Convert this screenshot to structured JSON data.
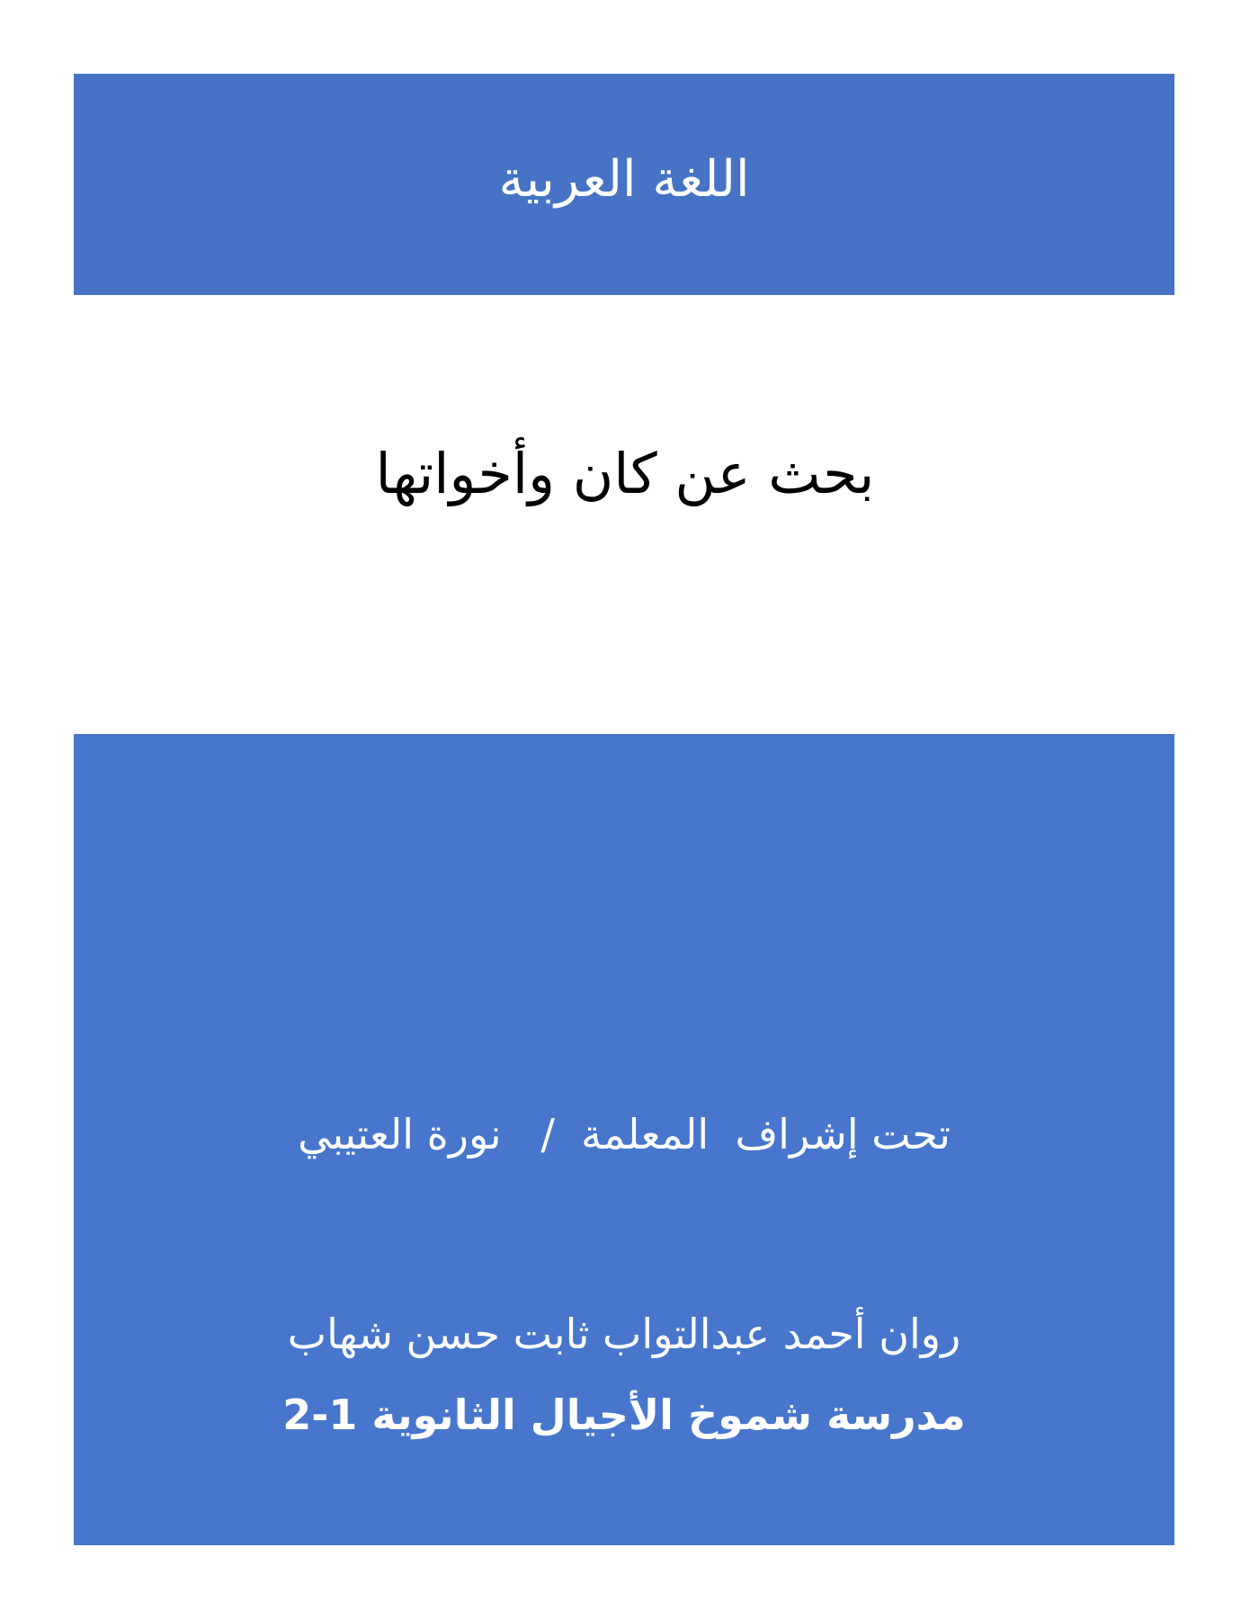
{
  "header": {
    "title": "اللغة العربية"
  },
  "main": {
    "title": "بحث عن كان وأخواتها"
  },
  "footer": {
    "supervision": "تحت إشراف  المعلمة  /   نورة العتيبي",
    "student_name": "روان أحمد عبدالتواب ثابت حسن شهاب",
    "school": "مدرسة شموخ الأجيال الثانوية 1-2"
  },
  "colors": {
    "header_background": "#4673c5",
    "footer_background": "#4776cc",
    "header_text": "#ffffff",
    "main_text": "#000000"
  }
}
